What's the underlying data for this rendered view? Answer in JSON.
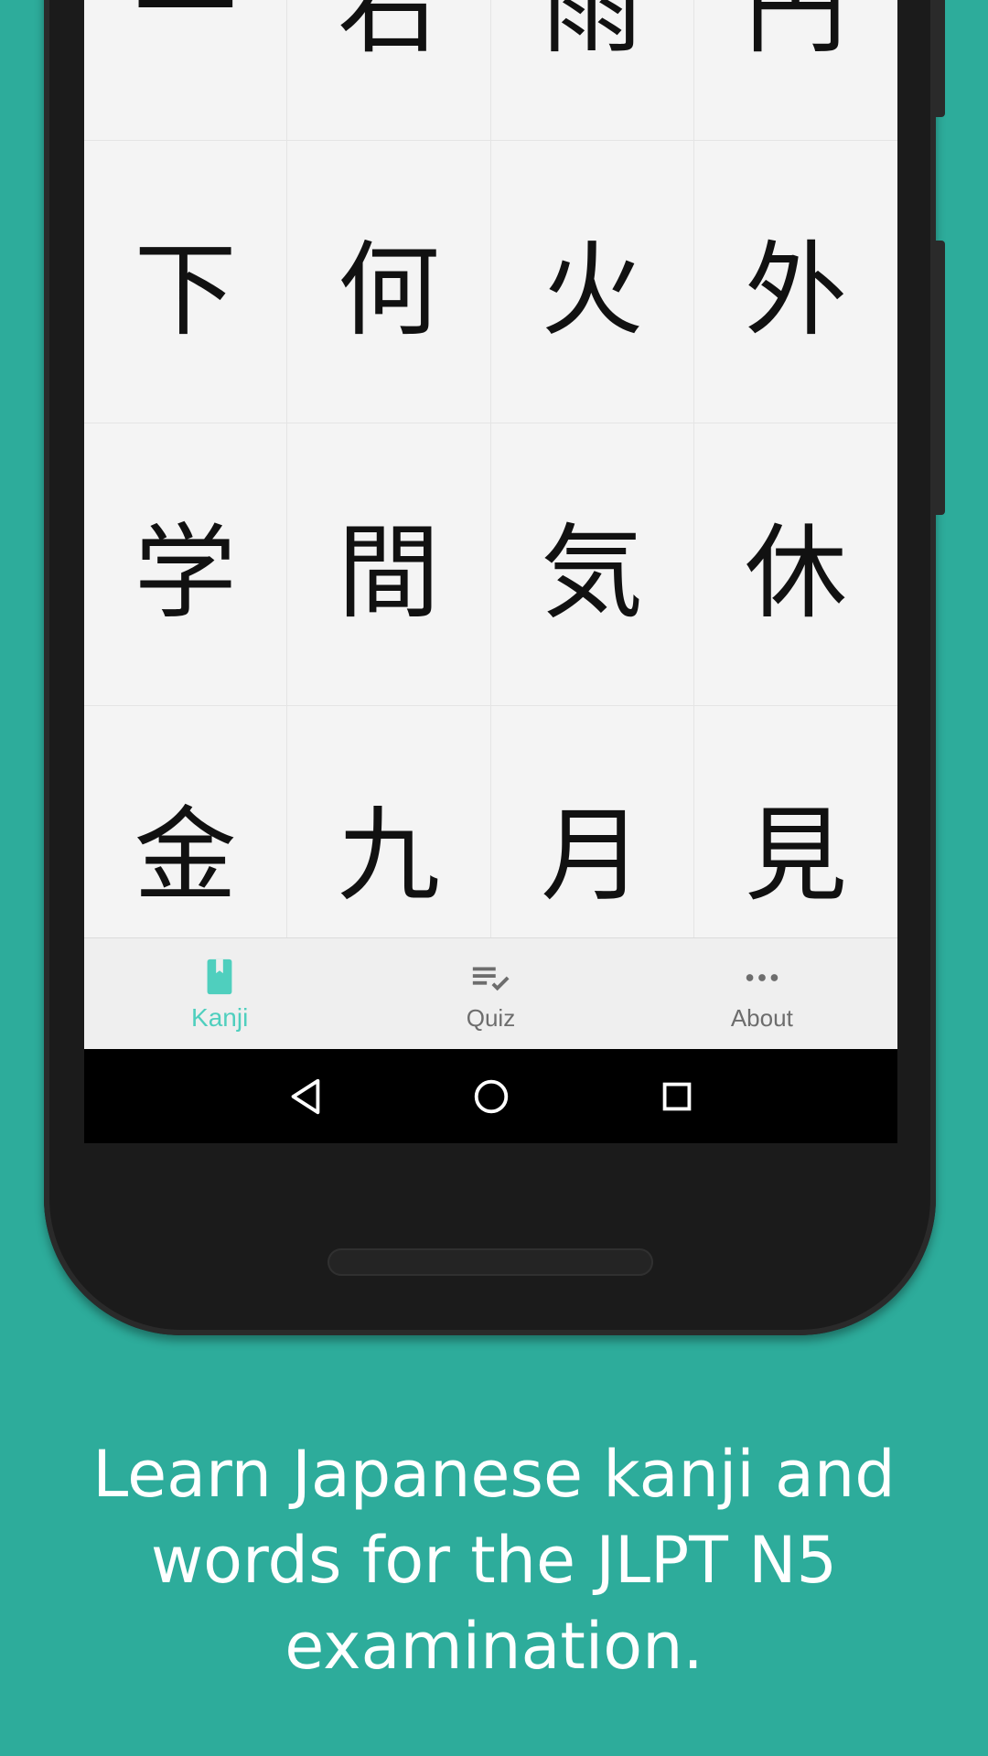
{
  "colors": {
    "background": "#2dac9b",
    "accent": "#4fcfbe",
    "inactive_nav": "#6d6d6d"
  },
  "kanji_grid": {
    "rows": [
      [
        "一",
        "右",
        "雨",
        "円"
      ],
      [
        "下",
        "何",
        "火",
        "外"
      ],
      [
        "学",
        "間",
        "気",
        "休"
      ],
      [
        "金",
        "九",
        "月",
        "見"
      ]
    ]
  },
  "bottom_nav": {
    "items": [
      {
        "label": "Kanji",
        "icon": "book-icon",
        "active": true
      },
      {
        "label": "Quiz",
        "icon": "quiz-checklist-icon",
        "active": false
      },
      {
        "label": "About",
        "icon": "more-dots-icon",
        "active": false
      }
    ]
  },
  "system_nav": {
    "back_icon": "back-triangle-icon",
    "home_icon": "home-circle-icon",
    "recents_icon": "recents-square-icon"
  },
  "caption": {
    "text": "Learn Japanese kanji and words for the JLPT N5 examination."
  }
}
